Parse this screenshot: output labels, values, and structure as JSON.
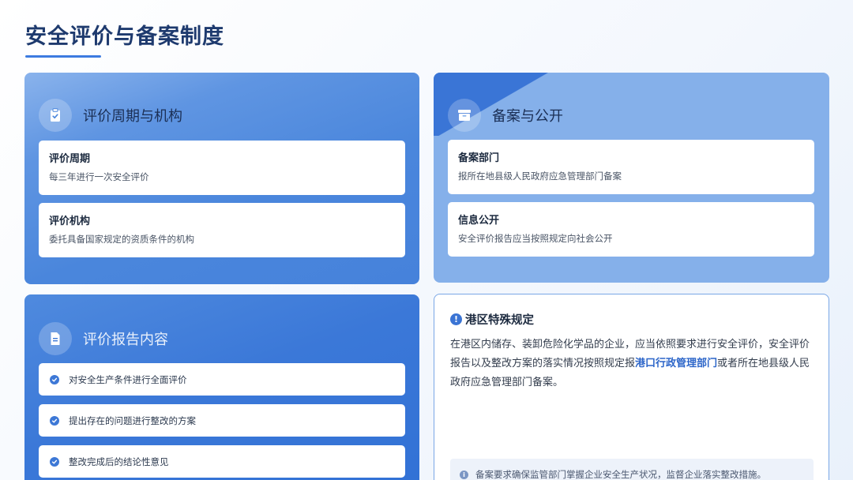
{
  "page": {
    "title": "安全评价与备案制度"
  },
  "card_cycle": {
    "icon": "clipboard-check-icon",
    "title": "评价周期与机构",
    "items": [
      {
        "title": "评价周期",
        "desc": "每三年进行一次安全评价"
      },
      {
        "title": "评价机构",
        "desc": "委托具备国家规定的资质条件的机构"
      }
    ]
  },
  "card_filing": {
    "icon": "archive-box-icon",
    "title": "备案与公开",
    "items": [
      {
        "title": "备案部门",
        "desc": "报所在地县级人民政府应急管理部门备案"
      },
      {
        "title": "信息公开",
        "desc": "安全评价报告应当按照规定向社会公开"
      }
    ]
  },
  "card_report": {
    "icon": "document-icon",
    "title": "评价报告内容",
    "checks": [
      "对安全生产条件进行全面评价",
      "提出存在的问题进行整改的方案",
      "整改完成后的结论性意见"
    ]
  },
  "card_port": {
    "icon": "info-icon",
    "title": "港区特殊规定",
    "body_part1": "在港区内储存、装卸危险化学品的企业，应当依照要求进行安全评价，安全评价报告以及整改方案的落实情况按照规定报",
    "body_highlight": "港口行政管理部门",
    "body_part2": "或者所在地县级人民政府应急管理部门备案。",
    "note": "备案要求确保监管部门掌握企业安全生产状况，监督企业落实整改措施。"
  },
  "colors": {
    "accent": "#3d7be0",
    "title": "#1e3a6e",
    "highlight": "#2d66c9"
  }
}
